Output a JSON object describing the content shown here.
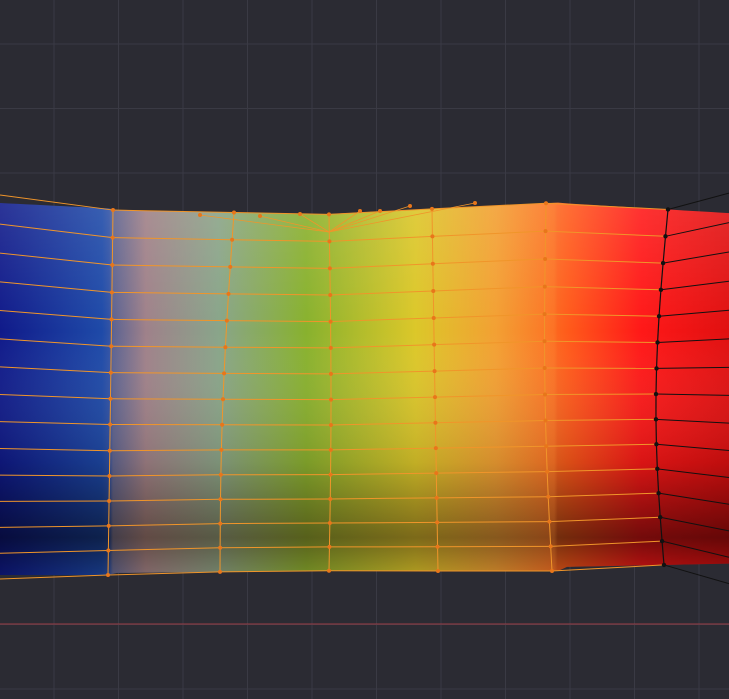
{
  "viewport": {
    "background": "#2b2b33",
    "grid_color": "#3a3a44",
    "axis_line_color": "#9a3c46"
  },
  "mesh": {
    "selection_color": "#f0952a",
    "unselected_wire_color": "#111111",
    "vertex_color": "#e8761a",
    "gradient_colors": [
      "#101a8a",
      "#1e4aa8",
      "#8a7a9a",
      "#6fa69a",
      "#6eb52a",
      "#d4d024",
      "#f0a030",
      "#ff5a1a",
      "#ff1818",
      "#d01010"
    ],
    "selection_state": "partially-selected"
  }
}
